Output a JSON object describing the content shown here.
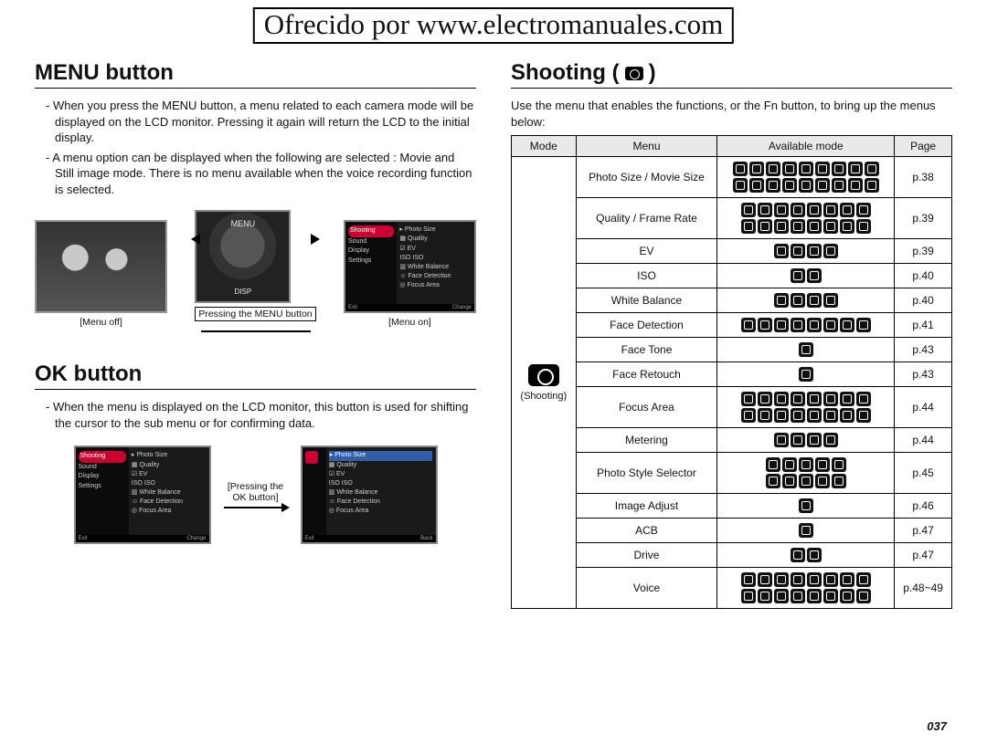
{
  "watermark": "Ofrecido por www.electromanuales.com",
  "page_number": "037",
  "left": {
    "menu_heading": "MENU button",
    "menu_p1": "- When you press the MENU button, a menu related to each camera mode will be displayed on the LCD monitor. Pressing it again will return the LCD to the initial display.",
    "menu_p2": "- A menu option can be displayed when the following are selected : Movie and Still image mode. There is no menu available when the voice recording function is selected.",
    "fig_mid_caption": "Pressing the MENU button",
    "fig_left_caption": "[Menu off]",
    "fig_right_caption": "[Menu on]",
    "ok_heading": "OK button",
    "ok_p1": "- When the menu is displayed on the LCD monitor, this button is used for shifting the cursor to the sub menu or for confirming data.",
    "ok_mid_caption_l1": "[Pressing the",
    "ok_mid_caption_l2": "OK button]",
    "menu_side_items": [
      "Shooting",
      "Sound",
      "Display",
      "Settings"
    ],
    "menu_main_items": [
      "Photo Size",
      "Quality",
      "EV",
      "ISO",
      "White Balance",
      "Face Detection",
      "Focus Area"
    ],
    "menu_exit": "Exit",
    "menu_change": "Change",
    "menu_back": "Back",
    "dial_menu": "MENU",
    "dial_disp": "DISP"
  },
  "right": {
    "heading": "Shooting (",
    "heading2": ")",
    "intro": "Use the menu that enables the functions, or the Fn button, to bring up the menus below:",
    "th_mode": "Mode",
    "th_menu": "Menu",
    "th_avail": "Available mode",
    "th_page": "Page",
    "mode_label": "(Shooting)",
    "rows": [
      {
        "menu": "Photo Size / Movie Size",
        "icons": 18,
        "page": "p.38"
      },
      {
        "menu": "Quality / Frame Rate",
        "icons": 16,
        "page": "p.39"
      },
      {
        "menu": "EV",
        "icons": 4,
        "page": "p.39"
      },
      {
        "menu": "ISO",
        "icons": 2,
        "page": "p.40"
      },
      {
        "menu": "White Balance",
        "icons": 4,
        "page": "p.40"
      },
      {
        "menu": "Face Detection",
        "icons": 8,
        "page": "p.41"
      },
      {
        "menu": "Face Tone",
        "icons": 1,
        "page": "p.43"
      },
      {
        "menu": "Face Retouch",
        "icons": 1,
        "page": "p.43"
      },
      {
        "menu": "Focus Area",
        "icons": 16,
        "page": "p.44"
      },
      {
        "menu": "Metering",
        "icons": 4,
        "page": "p.44"
      },
      {
        "menu": "Photo Style Selector",
        "icons": 10,
        "page": "p.45"
      },
      {
        "menu": "Image Adjust",
        "icons": 1,
        "page": "p.46"
      },
      {
        "menu": "ACB",
        "icons": 1,
        "page": "p.47"
      },
      {
        "menu": "Drive",
        "icons": 2,
        "page": "p.47"
      },
      {
        "menu": "Voice",
        "icons": 16,
        "page": "p.48~49"
      }
    ]
  }
}
